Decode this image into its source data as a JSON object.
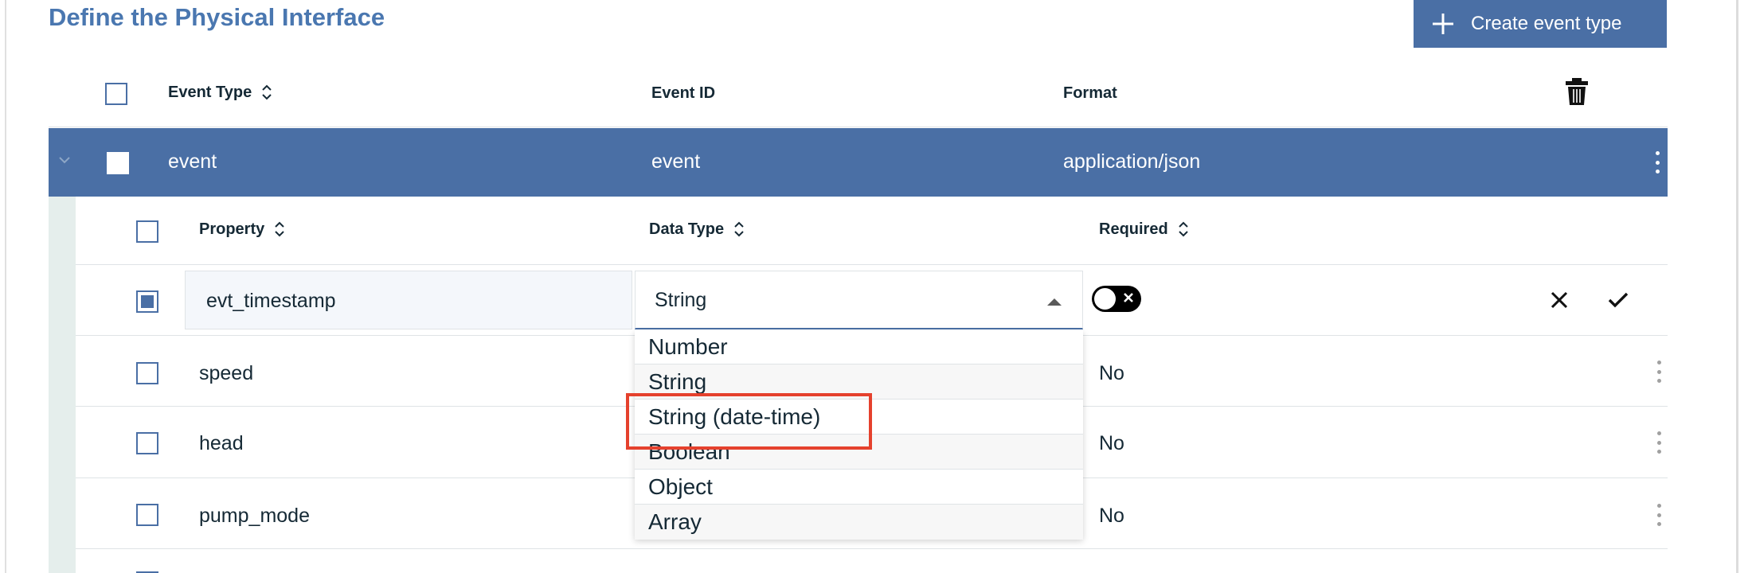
{
  "page": {
    "title": "Define the Physical Interface"
  },
  "toolbar": {
    "create_label": "Create event type"
  },
  "event_table": {
    "headers": {
      "event_type": "Event Type",
      "event_id": "Event ID",
      "format": "Format"
    },
    "rows": [
      {
        "event_type": "event",
        "event_id": "event",
        "format": "application/json"
      }
    ]
  },
  "property_table": {
    "headers": {
      "property": "Property",
      "data_type": "Data Type",
      "required": "Required"
    },
    "editing_row": {
      "property": "evt_timestamp",
      "data_type": "String",
      "required": false
    },
    "rows": [
      {
        "property": "speed",
        "required": "No"
      },
      {
        "property": "head",
        "required": "No"
      },
      {
        "property": "pump_mode",
        "required": "No"
      }
    ]
  },
  "dropdown": {
    "options": [
      "Number",
      "String",
      "String (date-time)",
      "Boolean",
      "Object",
      "Array"
    ],
    "highlighted": "String (date-time)"
  },
  "colors": {
    "accent": "#4a6fa5",
    "title": "#4a77b0",
    "highlight": "#e5412d",
    "text": "#152935"
  },
  "icons": [
    "plus-icon",
    "sort-icon",
    "trash-icon",
    "chevron-down-icon",
    "kebab-icon",
    "close-icon",
    "checkmark-icon",
    "caret-up-icon"
  ]
}
